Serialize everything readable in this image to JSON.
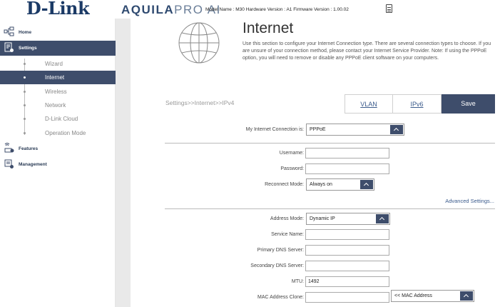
{
  "header": {
    "logo": "D-Link",
    "brand_bold": "AQUILA",
    "brand_light": "PRO AI",
    "model_info": "Model Name : M30 Hardware Version : A1 Firmware Version : 1.00.02"
  },
  "sidebar": {
    "home": "Home",
    "settings": "Settings",
    "subitems": [
      "Wizard",
      "Internet",
      "Wireless",
      "Network",
      "D-Link Cloud",
      "Operation Mode"
    ],
    "features": "Features",
    "management": "Management"
  },
  "main": {
    "title": "Internet",
    "description": "Use this section to configure your Internet Connection type. There are several connection types to choose. If you are unsure of your connection method, please contact your Internet Service Provider. Note: If using the PPPoE option, you will need to remove or disable any PPPoE client software on your computers.",
    "breadcrumb": "Settings>>Internet>>IPv4",
    "tab_vlan": "VLAN",
    "tab_ipv6": "IPv6",
    "save": "Save",
    "connection_label": "My Internet Connection is:",
    "connection_value": "PPPoE",
    "username_label": "Username:",
    "username_value": "",
    "password_label": "Password:",
    "password_value": "",
    "reconnect_label": "Reconnect Mode:",
    "reconnect_value": "Always on",
    "advanced": "Advanced Settings...",
    "address_mode_label": "Address Mode:",
    "address_mode_value": "Dynamic IP",
    "service_name_label": "Service Name:",
    "service_name_value": "",
    "primary_dns_label": "Primary DNS Server:",
    "primary_dns_value": "",
    "secondary_dns_label": "Secondary DNS Server:",
    "secondary_dns_value": "",
    "mtu_label": "MTU:",
    "mtu_value": "1492",
    "mac_clone_label": "MAC Address Clone:",
    "mac_clone_value": "",
    "mac_select": "<< MAC Address"
  },
  "colors": {
    "accent": "#3e4d6b",
    "link": "#3b5b8c",
    "band": "#e9e9e9"
  }
}
